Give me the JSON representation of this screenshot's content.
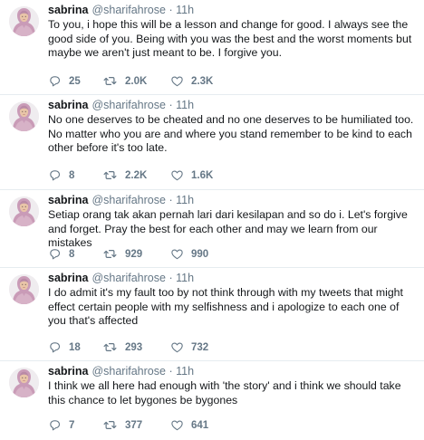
{
  "tweets": [
    {
      "name": "sabrina",
      "handle": "@sharifahrose",
      "dot": "·",
      "time": "11h",
      "text": "To you, i hope this will be a lesson and change for good. I always see the good side of you. Being with you was the best and the worst moments but maybe we aren't just meant to be. I forgive you.",
      "replies": "25",
      "retweets": "2.0K",
      "likes": "2.3K"
    },
    {
      "name": "sabrina",
      "handle": "@sharifahrose",
      "dot": "·",
      "time": "11h",
      "text": "No one deserves to be cheated and no one deserves to be humiliated too. No matter who you are and where you stand remember to be kind to each other before it's too late.",
      "replies": "8",
      "retweets": "2.2K",
      "likes": "1.6K"
    },
    {
      "name": "sabrina",
      "handle": "@sharifahrose",
      "dot": "·",
      "time": "11h",
      "text": "Setiap orang tak akan pernah lari dari kesilapan and so do i. Let's forgive and forget. Pray the best for each other and may we learn from our mistakes",
      "replies": "8",
      "retweets": "929",
      "likes": "990"
    },
    {
      "name": "sabrina",
      "handle": "@sharifahrose",
      "dot": "·",
      "time": "11h",
      "text": "I do admit it's my fault too by not think through with my tweets that might effect certain people with my selfishness and i apologize to each one of you that's affected",
      "replies": "18",
      "retweets": "293",
      "likes": "732"
    },
    {
      "name": "sabrina",
      "handle": "@sharifahrose",
      "dot": "·",
      "time": "11h",
      "text": "I think we all here had enough with 'the story' and i think we should take this chance to let bygones be bygones",
      "replies": "7",
      "retweets": "377",
      "likes": "641"
    }
  ],
  "icons": {
    "reply": "reply-icon",
    "retweet": "retweet-icon",
    "like": "heart-icon"
  },
  "colors": {
    "text": "#14171a",
    "muted": "#657786",
    "divider": "#e6ecf0"
  }
}
